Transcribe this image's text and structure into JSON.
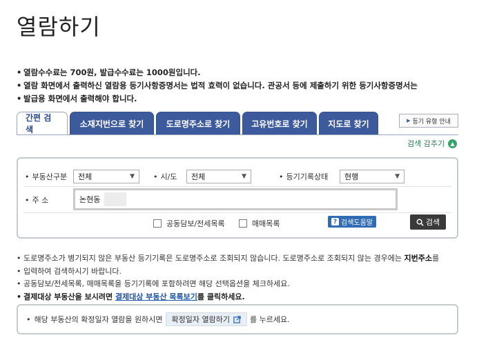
{
  "page": {
    "title": "열람하기"
  },
  "notices": [
    "열람수수료는 700원, 발급수수료는 1000원입니다.",
    "열람 화면에서 출력하신 열람용 등기사항증명서는 법적 효력이 없습니다. 관공서 등에 제출하기 위한 등기사항증명서는",
    "발급용 화면에서 출력해야 합니다."
  ],
  "tabs": [
    {
      "label": "간편 검색"
    },
    {
      "label": "소재지번으로 찾기"
    },
    {
      "label": "도로명주소로 찾기"
    },
    {
      "label": "고유번호로 찾기"
    },
    {
      "label": "지도로 찾기"
    }
  ],
  "guide_button": {
    "label": "등기 유형 안내"
  },
  "collapse_link": {
    "label": "검색 감추기"
  },
  "search": {
    "property_type": {
      "label": "부동산구분",
      "value": "전체"
    },
    "region": {
      "label": "시/도",
      "value": "전체"
    },
    "record_status": {
      "label": "등기기록상태",
      "value": "현행"
    },
    "address": {
      "label": "주 소",
      "value": "논현동"
    },
    "checkbox_joint": {
      "label": "공동담보/전세목록"
    },
    "checkbox_trade": {
      "label": "매매목록"
    },
    "help_button": {
      "label": "검색도움말"
    },
    "search_button": {
      "label": "검색"
    }
  },
  "info": {
    "line1_a": "도로명주소가 병기되지 않은 부동산 등기기록은 도로명주소로 조회되지 않습니다. 도로명주소로 조회되지 않는 경우에는 ",
    "line1_bold": "지번주소",
    "line1_b": "를",
    "line2": "입력하여 검색하시기 바랍니다.",
    "line3": "공동담보/전세목록, 매매목록을 등기기록에 포함하려면 해당 선택옵션을 체크하세요.",
    "line4_a": "결제대상 부동산을 보시려면 ",
    "line4_link": "결제대상 부동산 목록보기",
    "line4_b": "를 클릭하세요."
  },
  "bottom": {
    "text_a": "해당 부동산의 확정일자 열람을 원하시면",
    "button_label": "확정일자 열람하기",
    "text_b": "를 누르세요."
  }
}
